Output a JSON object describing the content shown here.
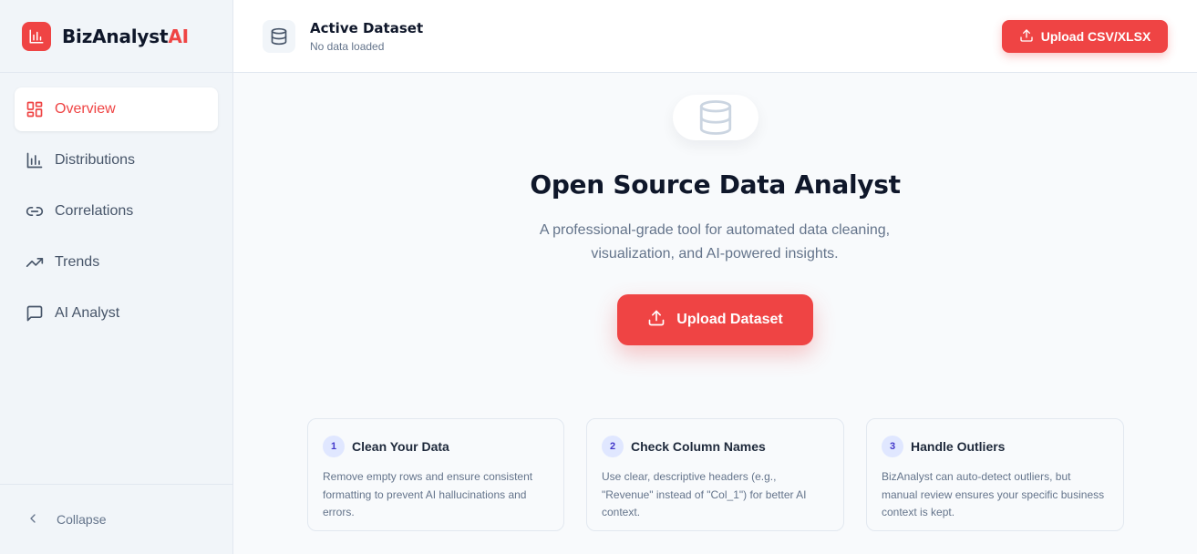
{
  "brand": {
    "name": "BizAnalyst",
    "accent": "AI",
    "icon": "bar-chart-icon",
    "color": "#ef4444"
  },
  "sidebar": {
    "items": [
      {
        "label": "Overview",
        "icon": "layout-grid-icon",
        "active": true
      },
      {
        "label": "Distributions",
        "icon": "bar-chart-icon",
        "active": false
      },
      {
        "label": "Correlations",
        "icon": "link-icon",
        "active": false
      },
      {
        "label": "Trends",
        "icon": "trending-up-icon",
        "active": false
      },
      {
        "label": "AI Analyst",
        "icon": "message-square-icon",
        "active": false
      }
    ],
    "collapse_label": "Collapse"
  },
  "header": {
    "title": "Active Dataset",
    "subtitle": "No data loaded",
    "upload_label": "Upload CSV/XLSX"
  },
  "hero": {
    "title": "Open Source Data Analyst",
    "subtitle": "A professional-grade tool for automated data cleaning, visualization, and AI-powered insights.",
    "button_label": "Upload Dataset"
  },
  "tips": [
    {
      "number": "1",
      "title": "Clean Your Data",
      "body": "Remove empty rows and ensure consistent formatting to prevent AI hallucinations and errors."
    },
    {
      "number": "2",
      "title": "Check Column Names",
      "body": "Use clear, descriptive headers (e.g., \"Revenue\" instead of \"Col_1\") for better AI context."
    },
    {
      "number": "3",
      "title": "Handle Outliers",
      "body": "BizAnalyst can auto-detect outliers, but manual review ensures your specific business context is kept."
    }
  ],
  "colors": {
    "accent": "#ef4444",
    "text": "#0f172a",
    "muted": "#64748b"
  }
}
